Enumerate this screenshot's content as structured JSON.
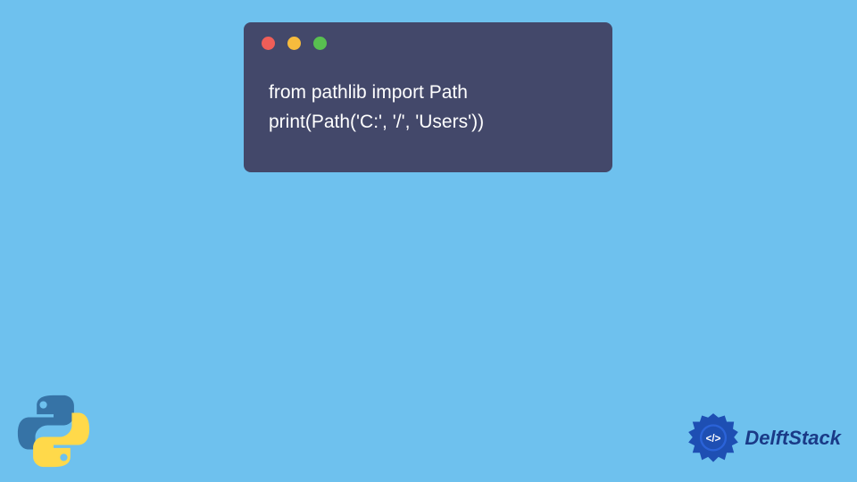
{
  "window": {
    "dot_colors": {
      "red": "#ef5e58",
      "yellow": "#f6bb3d",
      "green": "#58c050"
    }
  },
  "code": {
    "line1": "from pathlib import Path",
    "line2": "print(Path('C:', '/', 'Users'))"
  },
  "logos": {
    "python_name": "python-logo",
    "delft_text": "DelftStack",
    "delft_code_glyph": "</>"
  },
  "colors": {
    "background": "#6ec1ee",
    "window_bg": "#43486a",
    "code_text": "#ffffff",
    "delft_text": "#1a3a87"
  }
}
